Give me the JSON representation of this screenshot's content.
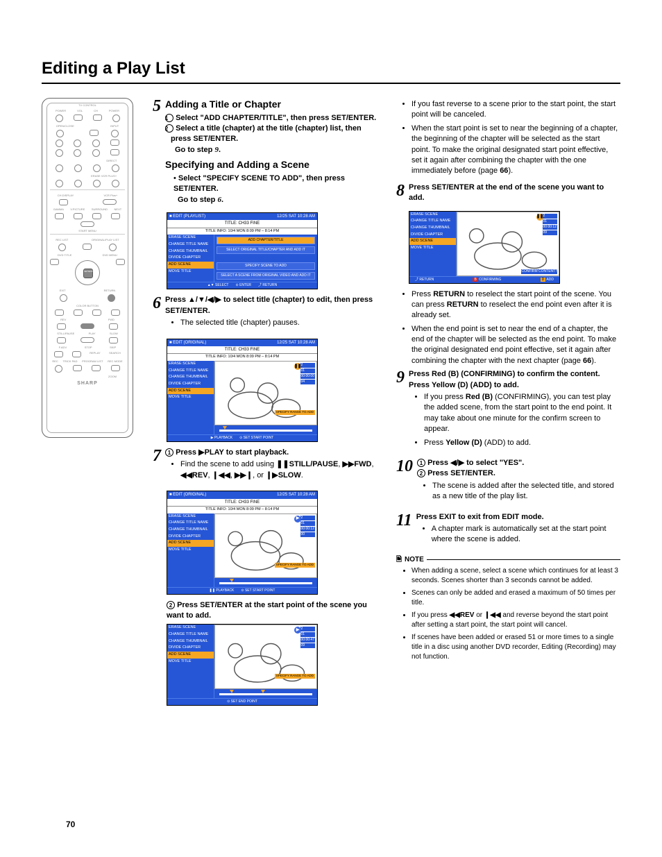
{
  "page": {
    "title": "Editing a Play List",
    "number": "70"
  },
  "remote": {
    "tv_control": "TV CONTROL",
    "power": "POWER",
    "vol": "VOL",
    "ch": "CH",
    "open_close": "OPEN/CLOSE",
    "input": "INPUT",
    "direct": "DIRECT",
    "erase_vcr_plus": "ERASE VCR PLUS+",
    "ch_display": "CH.DISPLAY",
    "vcr_plus": "VCR Plus+",
    "gamma": "GAMMA",
    "v_picture": "V.PICTURE",
    "surround": "SURROUND",
    "next": "NEXT",
    "start_menu": "START MENU",
    "rec_list": "REC LIST",
    "original_playlist": "ORIGINAL/PLAY LIST",
    "dvd_title": "DVD TITLE",
    "dvd_menu": "DVD MENU",
    "set_enter": "SET/ENTER",
    "exit": "EXIT",
    "return": "RETURN",
    "color_button": "COLOR BUTTON",
    "rev": "REV",
    "fwd": "FWD",
    "play": "PLAY",
    "still_pause": "STILL/PAUSE",
    "stop": "STOP",
    "slow": "SLOW",
    "fadv": "F.ADV",
    "skip": "SKIP",
    "replay": "REPLAY",
    "search": "SEARCH",
    "rec": "REC",
    "trick_pad": "TRICK PAD",
    "program_list": "PROGRAM LIST",
    "rec_mode": "REC MODE",
    "zoom": "ZOOM",
    "brand": "SHARP"
  },
  "steps": {
    "s5": {
      "num": "5",
      "heading": "Adding a Title or Chapter",
      "l1a": "Select \"ADD CHAPTER/TITLE\", then press ",
      "l1b": "SET/ENTER",
      "l1c": ".",
      "l2a": "Select a title (chapter) at the title (chapter) list, then press ",
      "l2b": "SET/ENTER",
      "l2c": ".",
      "l3": "Go to step ",
      "l3n": "9",
      "l3e": ".",
      "heading2": "Specifying and Adding a Scene",
      "l4a": "Select \"SPECIFY SCENE TO ADD\", then press ",
      "l4b": "SET/ENTER",
      "l4c": ".",
      "l5": "Go to step ",
      "l5n": "6",
      "l5e": "."
    },
    "s6": {
      "num": "6",
      "l1a": "Press ",
      "l1b": " to select title (chapter) to edit, then press ",
      "l1c": "SET/ENTER",
      "l1d": ".",
      "bullet": "The selected title (chapter) pauses."
    },
    "s7": {
      "num": "7",
      "l1a": "Press ",
      "l1b": "PLAY to start playback.",
      "b1a": "Find the scene to add using ",
      "b1b": "STILL/PAUSE",
      "b1c": ", ",
      "b1d": "FWD",
      "b1e": ", ",
      "b1f": "REV",
      "b1g": ", ",
      "b1h": ", or ",
      "b1i": "SLOW",
      "b1j": ".",
      "l2a": "Press ",
      "l2b": "SET/ENTER",
      "l2c": " at the start point of the scene you want to add."
    },
    "s8": {
      "num": "8",
      "l1a": "Press ",
      "l1b": "SET/ENTER",
      "l1c": " at the end of the scene you want to add.",
      "b1a": "Press ",
      "b1b": "RETURN",
      "b1c": " to reselect the start point of the scene. You can press ",
      "b1d": "RETURN",
      "b1e": " to reselect the end point even after it is already set.",
      "b2": "When the end point is set to near the end of a chapter, the end of the chapter will be selected as the end point. To make the original designated end point effective, set it again after combining the chapter with the next chapter (page ",
      "b2b": "66",
      "b2c": ")."
    },
    "s9": {
      "num": "9",
      "l1a": "Press ",
      "l1b": "Red (B)",
      "l1c": " (CONFIRMING) to confirm the content.",
      "l2a": "Press ",
      "l2b": "Yellow (D)",
      "l2c": " (ADD) to add.",
      "b1a": "If you press ",
      "b1b": "Red (B)",
      "b1c": " (CONFIRMING), you can test play the added scene, from the start point to the end point. It may take about one minute for the confirm screen to appear.",
      "b2a": "Press ",
      "b2b": "Yellow (D)",
      "b2c": " (ADD) to add."
    },
    "s10": {
      "num": "10",
      "l1a": "Press ",
      "l1b": " to select \"YES\".",
      "l2a": "Press ",
      "l2b": "SET/ENTER",
      "l2c": ".",
      "b1": "The scene is added after the selected title, and stored as a new title of the play list."
    },
    "s11": {
      "num": "11",
      "l1a": "Press ",
      "l1b": "EXIT",
      "l1c": " to exit from EDIT mode.",
      "b1": "A chapter mark is automatically set at the start point where the scene is added."
    },
    "right_intro": {
      "b1": "If you fast reverse to a scene prior to the start point, the start point will be canceled.",
      "b2a": "When the start point is set to near the beginning of a chapter, the beginning of the chapter will be selected as the start point. To make the original designated start point effective, set it again after combining the chapter with the one immediately before (page ",
      "b2b": "66",
      "b2c": ")."
    },
    "note": {
      "label": "NOTE",
      "b1": "When adding a scene, select a scene which continues for at least 3 seconds. Scenes shorter than 3 seconds cannot be added.",
      "b2": "Scenes can only be added and erased a maximum of 50 times per title.",
      "b3a": "If you press ",
      "b3b": "REV",
      "b3c": " or ",
      "b3d": " and reverse beyond the start point after setting a start point, the start point will cancel.",
      "b4": "If scenes have been added or erased 51 or more times to a single title in a disc using another DVD recorder, Editing (Recording) may not function."
    }
  },
  "screens": {
    "common": {
      "date": "12/25  SAT 10:28 AM",
      "title": "TITLE: CH33 FINE",
      "info": "TITLE INFO: 10/4 MON   8:09 PM – 8:14 PM",
      "menu": [
        "ERASE SCENE",
        "CHANGE TITLE NAME",
        "CHANGE THUMBNAIL",
        "DIVIDE CHAPTER",
        "ADD SCENE",
        "MOVE TITLE"
      ],
      "range_btn": "SPECIFY RANGE TO ADD"
    },
    "shot1": {
      "hdr": "EDIT (PLAYLIST)",
      "btn1": "ADD CHAPTER/TITLE",
      "btn1_sub": "SELECT ORIGINAL TITLE/CHAPTER AND ADD IT",
      "btn2": "SPECIFY SCENE TO ADD",
      "btn2_sub": "SELECT A SCENE FROM ORIGINAL VIDEO AND ADD IT",
      "bottom_select": "SELECT",
      "bottom_enter": "ENTER",
      "bottom_return": "RETURN"
    },
    "shot2": {
      "hdr": "EDIT (ORIGINAL)",
      "badges": [
        "2",
        "01",
        "00:00:00",
        "04"
      ],
      "bottom_play": "PLAYBACK",
      "bottom_set": "SET START POINT"
    },
    "shot3": {
      "hdr": "EDIT (ORIGINAL)",
      "badges": [
        "2",
        "01",
        "00:00:12",
        "00"
      ],
      "bottom_play": "PLAYBACK",
      "bottom_set": "SET START POINT"
    },
    "shot4": {
      "badges": [
        "2",
        "01",
        "00:00:47",
        "09"
      ],
      "bottom_set": "SET END POINT"
    },
    "shot5": {
      "badges": [
        "2",
        "01",
        "00:00:12",
        "09"
      ],
      "confirm": "CONFIRM CONTENT?",
      "bottom_return": "RETURN",
      "bottom_confirming": "CONFIRMING",
      "bottom_add": "ADD"
    }
  }
}
